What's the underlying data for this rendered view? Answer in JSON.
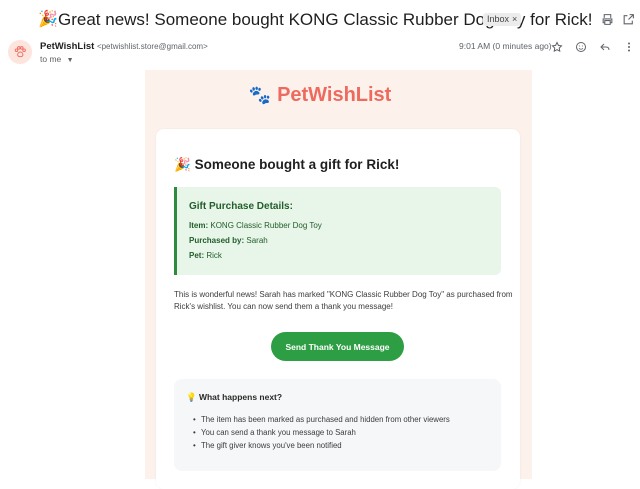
{
  "email": {
    "subject": "Great news! Someone bought KONG Classic Rubber Dog Toy for Rick!",
    "subject_emoji": "🎉",
    "label": "Inbox",
    "label_close": "×",
    "sender_name": "PetWishList",
    "sender_address": "<petwishlist.store@gmail.com>",
    "to_line": "to me",
    "time": "9:01 AM (0 minutes ago)",
    "icons": [
      "print-icon",
      "open-in-new-icon",
      "star-icon",
      "emoji-icon",
      "reply-icon",
      "more-vert-icon"
    ]
  },
  "body": {
    "brand": "PetWishList",
    "brand_icon": "🐾",
    "heading_emoji": "🎉",
    "heading": "Someone bought a gift for Rick!",
    "details": {
      "title": "Gift Purchase Details:",
      "item_label": "Item:",
      "item_value": "KONG Classic Rubber Dog Toy",
      "purchased_label": "Purchased by:",
      "purchased_value": "Sarah",
      "pet_label": "Pet:",
      "pet_value": "Rick"
    },
    "paragraph": "This is wonderful news! Sarah has marked \"KONG Classic Rubber Dog Toy\" as purchased from Rick's wishlist. You can now send them a thank you message!",
    "button": "Send Thank You Message",
    "next": {
      "emoji": "💡",
      "title": "What happens next?",
      "items": [
        "The item has been marked as purchased and hidden from other viewers",
        "You can send a thank you message to Sarah",
        "The gift giver knows you've been notified"
      ]
    }
  },
  "colors": {
    "brand": "#ee6a5f",
    "accent_green": "#2e9e45",
    "details_bg": "#e8f5e9",
    "outer_bg": "#fdf1ec"
  }
}
